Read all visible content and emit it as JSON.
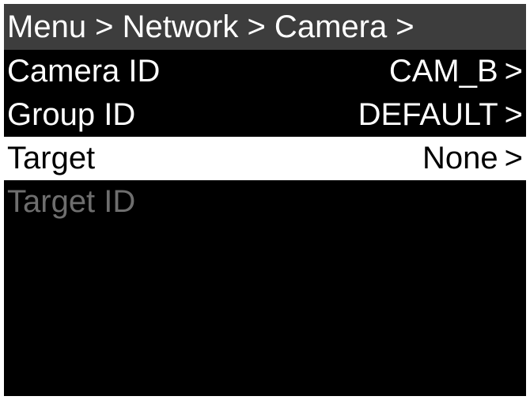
{
  "breadcrumb": {
    "text": "Menu > Network > Camera >"
  },
  "menu": {
    "items": [
      {
        "label": "Camera ID",
        "value": "CAM_B",
        "chevron": ">"
      },
      {
        "label": "Group ID",
        "value": "DEFAULT",
        "chevron": ">"
      },
      {
        "label": "Target",
        "value": "None",
        "chevron": ">"
      },
      {
        "label": "Target ID",
        "value": "",
        "chevron": ""
      }
    ],
    "selected_index": 2,
    "disabled_index": 3
  },
  "colors": {
    "background": "#000000",
    "header_bar": "#3d3d3d",
    "text": "#ffffff",
    "selected_background": "#ffffff",
    "selected_text": "#000000",
    "disabled_text": "#6e6e6e"
  }
}
